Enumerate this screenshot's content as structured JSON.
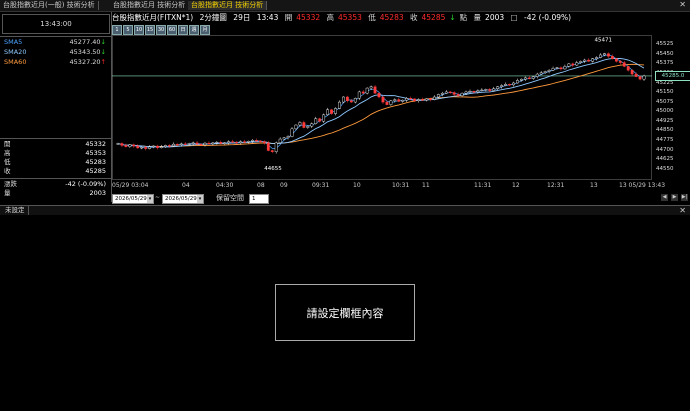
{
  "tabs": [
    {
      "label": "台股指數近月(一般) 技術分析",
      "active": false
    },
    {
      "label": "台股指數近月 技術分析",
      "active": false
    },
    {
      "label": "台股指數近月 技術分析",
      "active": true
    }
  ],
  "left_panel": {
    "clock": "13:43:00",
    "sma": [
      {
        "name": "SMA5",
        "value": "45277.40",
        "arrow": "down",
        "color": "#4da3ff"
      },
      {
        "name": "SMA20",
        "value": "45343.50",
        "arrow": "down",
        "color": "#8ec8ff"
      },
      {
        "name": "SMA60",
        "value": "45327.20",
        "arrow": "up",
        "color": "#ff9a3c"
      }
    ],
    "quotes": [
      {
        "name": "開",
        "value": "45332"
      },
      {
        "name": "高",
        "value": "45353"
      },
      {
        "name": "低",
        "value": "45283"
      },
      {
        "name": "收",
        "value": "45285"
      }
    ],
    "change_label": "漲跌",
    "change_value": "-42 (-0.09%)",
    "volume_label": "量",
    "volume_value": "2003"
  },
  "header": {
    "symbol": "台股指數近月(FITXN*1)",
    "interval": "2分鐘圖",
    "date_label": "29日",
    "time": "13:43",
    "open_label": "開",
    "open": "45332",
    "high_label": "高",
    "high": "45353",
    "low_label": "低",
    "low": "45283",
    "close_label": "收",
    "close": "45285",
    "close_unit": "點",
    "vol_label": "量",
    "vol": "2003",
    "chg": "-42 (-0.09%)"
  },
  "period_buttons": [
    "1",
    "5",
    "10",
    "15",
    "30",
    "60",
    "日",
    "週",
    "月"
  ],
  "chart_data": {
    "type": "candlestick",
    "ylim": [
      44500,
      45575
    ],
    "y_ticks": [
      45525,
      45450,
      45375,
      45300,
      45225,
      45150,
      45075,
      45000,
      44925,
      44850,
      44775,
      44700,
      44625,
      44550
    ],
    "current_price": "45285.0",
    "x_ticks": [
      "05/29 03:04",
      "04",
      "04:30",
      "08",
      "09",
      "09:31",
      "10",
      "10:31",
      "11",
      "11:31",
      "12",
      "12:31",
      "13",
      "13 05/29 13:43"
    ],
    "annotations": [
      {
        "label": "45471",
        "kind": "high"
      },
      {
        "label": "44655",
        "kind": "low"
      }
    ],
    "series": [
      {
        "name": "SMA5",
        "color": "#4da3ff"
      },
      {
        "name": "SMA20",
        "color": "#8ec8ff"
      },
      {
        "name": "SMA60",
        "color": "#ff9a3c"
      }
    ],
    "close": [
      44755,
      44740,
      44730,
      44745,
      44735,
      44720,
      44725,
      44715,
      44728,
      44735,
      44722,
      44730,
      44740,
      44736,
      44750,
      44745,
      44752,
      44748,
      44755,
      44760,
      44750,
      44745,
      44758,
      44752,
      44760,
      44765,
      44755,
      44760,
      44770,
      44766,
      44760,
      44770,
      44765,
      44772,
      44780,
      44775,
      44770,
      44760,
      44700,
      44690,
      44760,
      44790,
      44800,
      44810,
      44870,
      44900,
      44920,
      44880,
      44890,
      44910,
      44950,
      44930,
      44980,
      45020,
      44990,
      45030,
      45080,
      45120,
      45090,
      45080,
      45110,
      45160,
      45150,
      45190,
      45200,
      45150,
      45120,
      45080,
      45060,
      45090,
      45100,
      45085,
      45095,
      45110,
      45105,
      45090,
      45100,
      45095,
      45105,
      45100,
      45120,
      45140,
      45150,
      45160,
      45155,
      45140,
      45130,
      45150,
      45160,
      45165,
      45160,
      45170,
      45175,
      45180,
      45170,
      45185,
      45200,
      45210,
      45220,
      45215,
      45230,
      45250,
      45260,
      45270,
      45265,
      45280,
      45300,
      45310,
      45320,
      45330,
      45345,
      45350,
      45340,
      45360,
      45380,
      45370,
      45390,
      45400,
      45410,
      45400,
      45420,
      45430,
      45450,
      45460,
      45440,
      45420,
      45400,
      45390,
      45360,
      45330,
      45300,
      45280,
      45260,
      45285
    ]
  },
  "date_from": "2026/05/29",
  "date_to": "2026/05/29",
  "keep_space_label": "保留空間",
  "keep_space_value": "1",
  "lower_tab_label": "未設定",
  "placeholder_text": "請設定欄框內容"
}
